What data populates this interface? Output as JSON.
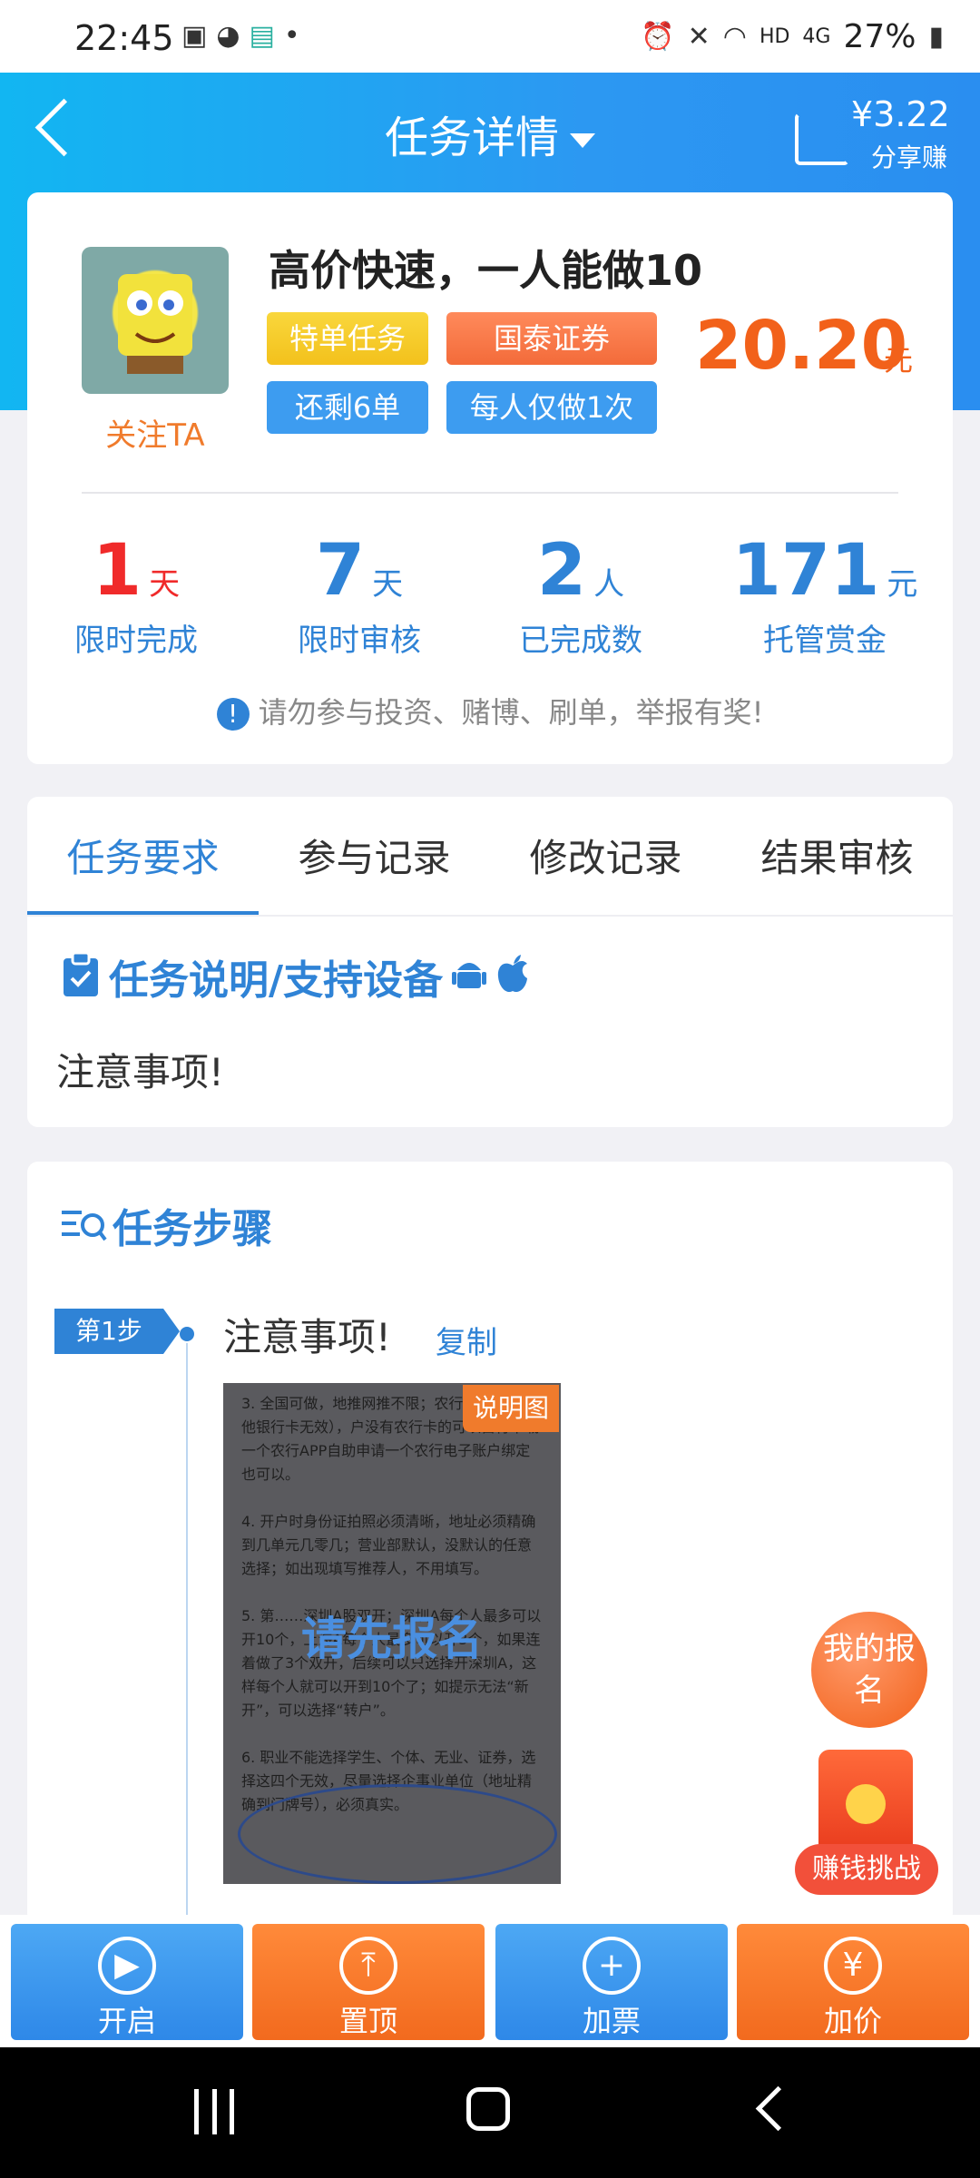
{
  "status_bar": {
    "time": "22:45",
    "dot": "•",
    "network": "HD",
    "signal": "4G",
    "battery": "27%"
  },
  "header": {
    "title": "任务详情",
    "share_amount": "¥3.22",
    "share_label": "分享赚"
  },
  "task": {
    "title": "高价快速，一人能做10",
    "follow_label": "关注TA",
    "tags": [
      "特单任务",
      "国泰证券",
      "还剩6单",
      "每人仅做1次"
    ],
    "price": "20.20",
    "price_unit": "元"
  },
  "stats": [
    {
      "value": "1",
      "unit": "天",
      "label": "限时完成",
      "color": "#f02a2a"
    },
    {
      "value": "7",
      "unit": "天",
      "label": "限时审核",
      "color": "#2f83d6"
    },
    {
      "value": "2",
      "unit": "人",
      "label": "已完成数",
      "color": "#2f83d6"
    },
    {
      "value": "171",
      "unit": "元",
      "label": "托管赏金",
      "color": "#2f83d6"
    }
  ],
  "notice": "请勿参与投资、赌博、刷单，举报有奖!",
  "tabs": [
    "任务要求",
    "参与记录",
    "修改记录",
    "结果审核"
  ],
  "description": {
    "title": "任务说明/支持设备",
    "text": "注意事项!"
  },
  "steps": {
    "title": "任务步骤",
    "step_label": "第1步",
    "step_text": "注意事项!",
    "copy_label": "复制",
    "image_badge": "说明图",
    "image_overlay": "请先报名",
    "image_text": "3. 全国可做，地推网推不限；农行卡（绑定其他银行卡无效），户没有农行卡的可以自行下载一个农行APP自助申请一个农行电子账户绑定也可以。\n\n4. 开户时身份证拍照必须清晰，地址必须精确到几单元几零几；营业部默认，没默认的任意选择；如出现填写推荐人，不用填写。\n\n5. 第……深圳A股双开；深圳A每个人最多可以开10个，上海A每个人最多可以开3个，如果连着做了3个双开，后续可以只选择开深圳A，这样每个人就可以开到10个了；如提示无法“新开”，可以选择“转户”。\n\n6. 职业不能选择学生、个体、无业、证券，选择这四个无效，尽量选择企事业单位（地址精确到门牌号），必须真实。"
  },
  "floating": {
    "my_apply": "我的报名",
    "earn_challenge": "赚钱挑战"
  },
  "bottom_buttons": [
    {
      "label": "开启",
      "icon": "play-icon"
    },
    {
      "label": "置顶",
      "icon": "pin-top-icon"
    },
    {
      "label": "加票",
      "icon": "plus-icon"
    },
    {
      "label": "加价",
      "icon": "yen-plus-icon"
    }
  ]
}
